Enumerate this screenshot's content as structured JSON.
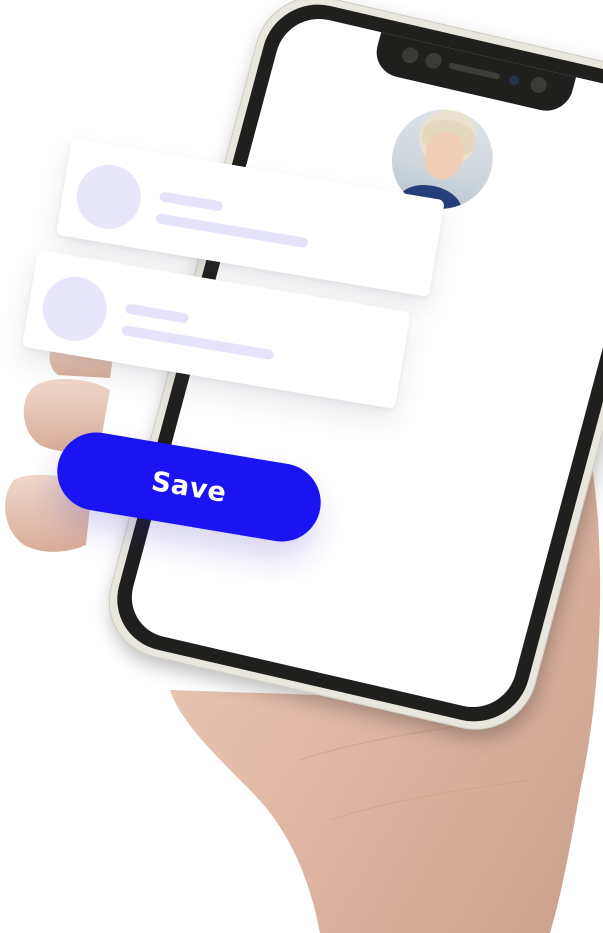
{
  "screen": {
    "accent_color": "#1a14f2",
    "placeholder_color": "#e6e4fb"
  },
  "profile": {
    "avatar_icon": "user-photo-avatar"
  },
  "cards": [
    {
      "avatar_icon": "placeholder-circle"
    },
    {
      "avatar_icon": "placeholder-circle"
    }
  ],
  "actions": {
    "save_label": "Save"
  }
}
